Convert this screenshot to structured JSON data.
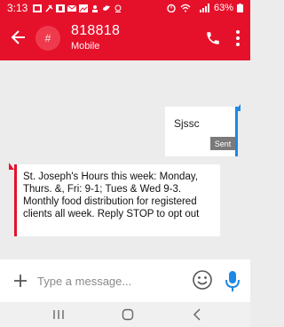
{
  "status_bar": {
    "time": "3:13",
    "battery": "63%",
    "bg_color": "#e5112b"
  },
  "header": {
    "avatar_glyph": "#",
    "contact_name": "818818",
    "contact_type": "Mobile",
    "back_icon": "arrow-left-icon",
    "call_icon": "phone-icon",
    "menu_icon": "more-vert-icon",
    "bg_color": "#e5112b"
  },
  "messages": [
    {
      "direction": "sent",
      "text": "Sjssc",
      "status": "Sent",
      "accent_color": "#1e88e5"
    },
    {
      "direction": "received",
      "text": "St. Joseph's Hours this week: Monday, Thurs. &, Fri: 9-1; Tues & Wed 9-3.  Monthly food distribution for registered clients all week.  Reply STOP to opt out",
      "accent_color": "#e5112b"
    }
  ],
  "compose": {
    "placeholder": "Type a message...",
    "plus_icon": "plus-icon",
    "emoji_icon": "emoji-icon",
    "mic_icon": "mic-icon",
    "mic_color": "#1e88e5"
  },
  "nav_bar": {
    "recents_icon": "recents-icon",
    "home_icon": "home-icon",
    "back_icon": "back-chevron-icon"
  }
}
